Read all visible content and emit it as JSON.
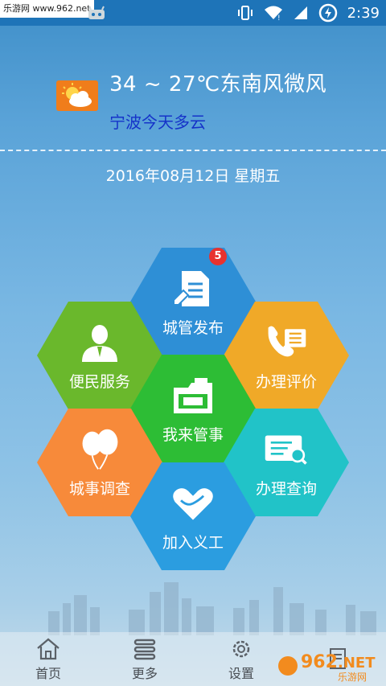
{
  "status_bar": {
    "watermark": "乐游网 www.962.net",
    "time": "2:39",
    "icons": [
      "android-icon",
      "vibrate-icon",
      "wifi-icon",
      "signal-icon",
      "battery-charging-icon"
    ]
  },
  "weather": {
    "icon": "partly-cloudy-icon",
    "temperature_wind": "34 ~ 27℃东南风微风",
    "city_forecast": "宁波今天多云"
  },
  "date_text": "2016年08月12日  星期五",
  "menu": {
    "publish": {
      "label": "城管发布",
      "badge": "5",
      "icon": "document-edit-icon"
    },
    "service": {
      "label": "便民服务",
      "icon": "person-icon"
    },
    "evaluate": {
      "label": "办理评价",
      "icon": "phone-list-icon"
    },
    "report": {
      "label": "我来管事",
      "icon": "camera-folder-icon"
    },
    "survey": {
      "label": "城事调查",
      "icon": "balloons-icon"
    },
    "query": {
      "label": "办理查询",
      "icon": "search-card-icon"
    },
    "volunteer": {
      "label": "加入义工",
      "icon": "heart-hands-icon"
    }
  },
  "bottom_nav": [
    {
      "label": "首页",
      "icon": "home-icon"
    },
    {
      "label": "更多",
      "icon": "menu-icon"
    },
    {
      "label": "设置",
      "icon": "gear-icon"
    },
    {
      "label": "",
      "icon": "document-icon"
    }
  ],
  "watermark_bottom": "962.NET 乐游网",
  "colors": {
    "status_bar": "#1e74b8",
    "hex_publish": "#2e8fd6",
    "hex_service": "#6ab82c",
    "hex_evaluate": "#f0a928",
    "hex_report": "#2dbd35",
    "hex_survey": "#f78a3a",
    "hex_query": "#21c3c8",
    "hex_volunteer": "#2b9de0",
    "weather_icon_bg": "#f07d1b",
    "badge": "#e8322f",
    "city_text": "#1533c9"
  }
}
